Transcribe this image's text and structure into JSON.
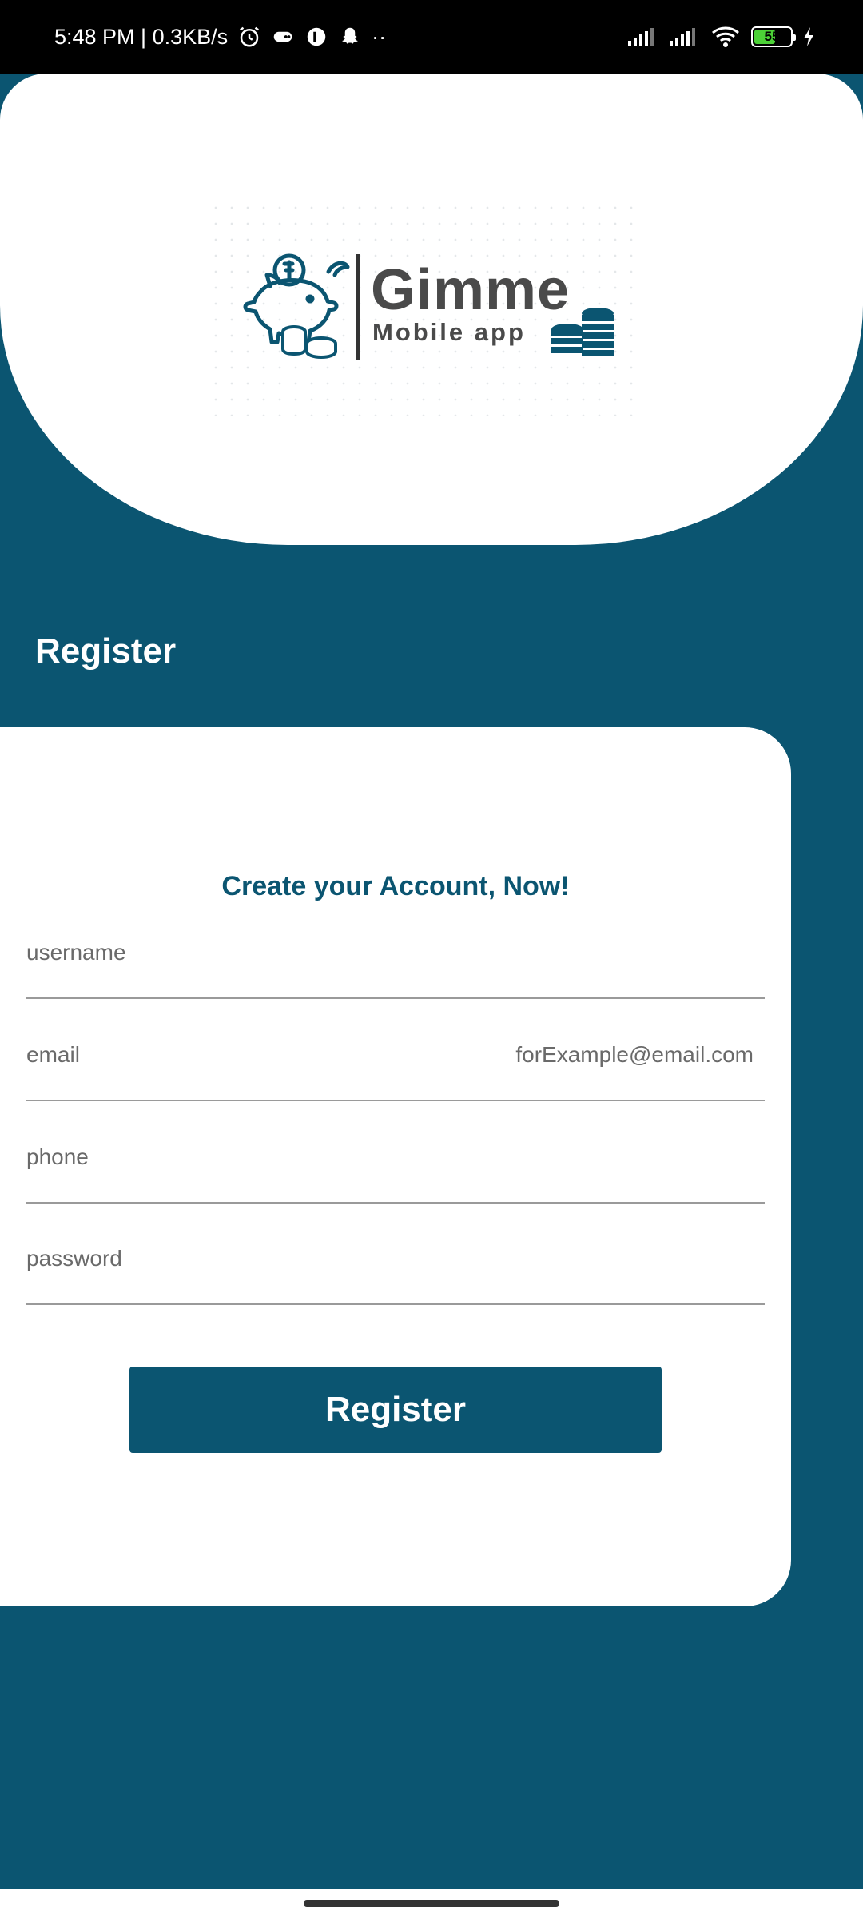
{
  "status_bar": {
    "time": "5:48 PM | 0.3KB/s",
    "extra": "··",
    "battery": "55",
    "icons_left": [
      "alarm-icon",
      "game-icon",
      "app-icon",
      "snapchat-icon"
    ],
    "icons_right": [
      "cell-signal-icon",
      "cell-signal-icon",
      "wifi-icon",
      "battery-icon",
      "charging-icon"
    ]
  },
  "logo": {
    "title": "Gimme",
    "subtitle": "Mobile app",
    "accent_color": "#0b5571"
  },
  "page": {
    "heading": "Register"
  },
  "form": {
    "title": "Create your Account, Now!",
    "fields": [
      {
        "label": "username",
        "hint": ""
      },
      {
        "label": "email",
        "hint": "forExample@email.com"
      },
      {
        "label": "phone",
        "hint": ""
      },
      {
        "label": "password",
        "hint": ""
      }
    ],
    "submit_label": "Register"
  },
  "colors": {
    "primary": "#0b5571",
    "card": "#ffffff",
    "text_muted": "#6a6a6a"
  }
}
